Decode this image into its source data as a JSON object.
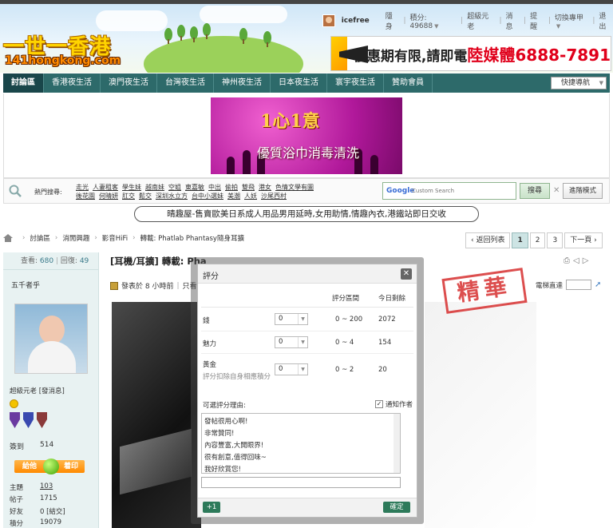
{
  "site": {
    "logo_text": "一世一香港",
    "logo_url": "141hongkong.com"
  },
  "userbar": {
    "username": "icefree",
    "stealth": "隱身",
    "points_label": "積分: 49688",
    "group": "超級元老",
    "messages": "消息",
    "reminders": "提醒",
    "switch_style": "切換專甲",
    "logout": "退出"
  },
  "top_ad": {
    "text": "優惠期有限,請即電",
    "brand": "陸媒體",
    "phone": "6888-7891"
  },
  "nav": {
    "items": [
      "討論區",
      "香港夜生活",
      "澳門夜生活",
      "台灣夜生活",
      "神州夜生活",
      "日本夜生活",
      "寰宇夜生活",
      "贊助會員"
    ],
    "quicknav": "快捷導航"
  },
  "promo": {
    "title": "1心1意",
    "subtitle": "優質浴巾消毒清洗"
  },
  "search": {
    "hot_label": "熱門搜尋:",
    "hotwords_row1": [
      "走光",
      "人妻租客",
      "學生妹",
      "越南妹",
      "空姐",
      "東嘉敏",
      "中出",
      "偷拍",
      "雙飛",
      "港女",
      "色情文學有圖"
    ],
    "hotwords_row2": [
      "後花園",
      "何晴妍",
      "肛交",
      "鬆交",
      "深圳水立方",
      "台中小選妹",
      "美潮",
      "人妖",
      "沙尾西村"
    ],
    "google_label": "Google",
    "placeholder": "Custom Search",
    "search_button": "搜尋",
    "advanced_button": "進階模式"
  },
  "announcement": "晴趣屋-售賣歐美日系成人用品男用延時,女用助情,情趣內衣,港鐵站即日交收",
  "breadcrumb": [
    "討論區",
    "消閒興趣",
    "影音HiFi",
    "轉載: Phatlab Phantasy隨身耳擴"
  ],
  "pager": {
    "back": "返回列表",
    "pages": [
      "1",
      "2",
      "3"
    ],
    "next": "下一頁"
  },
  "sidebar": {
    "views_label": "查看:",
    "views": "680",
    "replies_label": "回復:",
    "replies": "49",
    "author": "五千者乎",
    "rank": "超級元老 [發消息]",
    "signin_label": "簽到",
    "signin_value": "514",
    "friend_left": "給他",
    "friend_right": "着印",
    "profile": [
      {
        "label": "主題",
        "value": "103"
      },
      {
        "label": "帖子",
        "value": "1715"
      },
      {
        "label": "好友",
        "value": "0 [結交]"
      },
      {
        "label": "積分",
        "value": "19079"
      }
    ]
  },
  "post": {
    "title": "[耳機/耳擴] 轉載: Phatlab Phantasy隨身耳擴",
    "meta_posted": "發表於 8 小時前",
    "meta_only": "只看",
    "elevator_label": "電梯直達",
    "stamp": "精華"
  },
  "rating_dialog": {
    "title": "評分",
    "col_range": "評分區間",
    "col_today": "今日剩餘",
    "rows": [
      {
        "label": "錢",
        "value": "0",
        "range": "0 ~ 200",
        "remaining": "2072"
      },
      {
        "label": "魅力",
        "value": "0",
        "range": "0 ~ 4",
        "remaining": "154"
      },
      {
        "label": "黃金",
        "note": "評分扣除自身相應積分",
        "value": "0",
        "range": "0 ~ 2",
        "remaining": "20"
      }
    ],
    "reason_label": "可選評分理由:",
    "notify_label": "通知作者",
    "reasons": [
      "發帖很用心啊!",
      "非常贊同!",
      "內容豐富,大開眼界!",
      "很有創意,值得回味~",
      "我好欣賞您!"
    ],
    "plus_label": "+1",
    "confirm_label": "確定"
  }
}
